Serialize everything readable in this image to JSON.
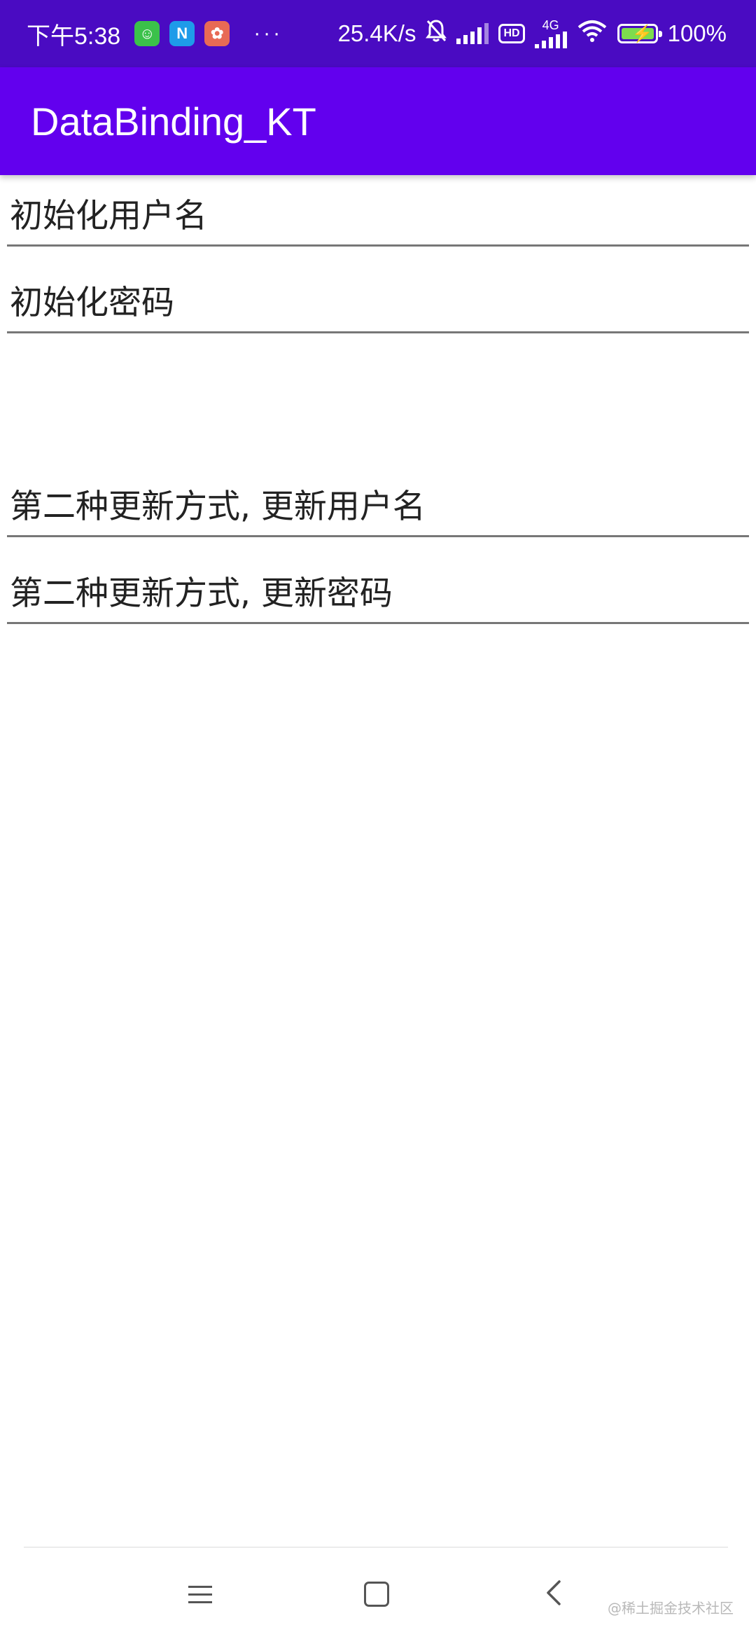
{
  "status_bar": {
    "time": "下午5:38",
    "apps": [
      {
        "icon": "wechat-green-icon",
        "glyph": "☺",
        "color": "#3bc14a"
      },
      {
        "icon": "n-app-icon",
        "glyph": "N",
        "color": "#1e9be9"
      },
      {
        "icon": "mascot-app-icon",
        "glyph": "✿",
        "color": "#e86a55"
      }
    ],
    "overflow": "···",
    "speed": "25.4K/s",
    "hd": "HD",
    "network": "4G",
    "battery_text": "100%",
    "battery_level": 1.0,
    "battery_color": "#7ddc4e"
  },
  "app_bar": {
    "title": "DataBinding_KT",
    "color": "#6200ee"
  },
  "fields": [
    {
      "value": "初始化用户名"
    },
    {
      "value": "初始化密码"
    },
    {
      "value": "第二种更新方式, 更新用户名"
    },
    {
      "value": "第二种更新方式, 更新密码"
    }
  ],
  "nav_bar": {
    "buttons": [
      "menu",
      "home",
      "back"
    ]
  },
  "watermark": "@稀土掘金技术社区"
}
